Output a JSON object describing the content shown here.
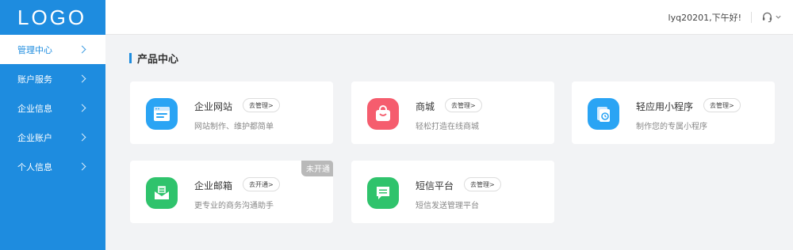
{
  "logo": "LOGO",
  "sidebar": {
    "items": [
      {
        "label": "管理中心"
      },
      {
        "label": "账户服务"
      },
      {
        "label": "企业信息"
      },
      {
        "label": "企业账户"
      },
      {
        "label": "个人信息"
      }
    ]
  },
  "header": {
    "greeting": "lyq20201,下午好!"
  },
  "section": {
    "title": "产品中心"
  },
  "products": [
    {
      "name": "企业网站",
      "action": "去管理>",
      "desc": "网站制作、维护都简单",
      "icon": "website-icon",
      "color": "#2aa4f4"
    },
    {
      "name": "商城",
      "action": "去管理>",
      "desc": "轻松打造在线商城",
      "icon": "shopping-bag-icon",
      "color": "#f55d6e"
    },
    {
      "name": "轻应用小程序",
      "action": "去管理>",
      "desc": "制作您的专属小程序",
      "icon": "mini-program-icon",
      "color": "#2aa4f4"
    },
    {
      "name": "企业邮箱",
      "action": "去开通>",
      "desc": "更专业的商务沟通助手",
      "icon": "mail-icon",
      "color": "#2fc36c",
      "badge": "未开通"
    },
    {
      "name": "短信平台",
      "action": "去管理>",
      "desc": "短信发送管理平台",
      "icon": "sms-icon",
      "color": "#2fc36c"
    }
  ],
  "colors": {
    "accent": "#1e8cdf",
    "sidebar_bg": "#1e8cdf"
  }
}
